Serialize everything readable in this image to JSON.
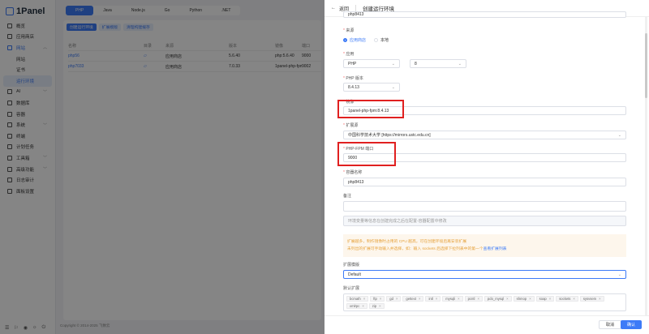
{
  "app": {
    "logo": "1Panel"
  },
  "sidebar": {
    "items": [
      {
        "label": "概览"
      },
      {
        "label": "应用商店"
      },
      {
        "label": "网站"
      },
      {
        "label": "网站"
      },
      {
        "label": "证书"
      },
      {
        "label": "运行环境"
      },
      {
        "label": "AI"
      },
      {
        "label": "数据库"
      },
      {
        "label": "容器"
      },
      {
        "label": "系统"
      },
      {
        "label": "终端"
      },
      {
        "label": "计划任务"
      },
      {
        "label": "工具箱"
      },
      {
        "label": "高级功能"
      },
      {
        "label": "日志审计"
      },
      {
        "label": "面板设置"
      }
    ]
  },
  "runtime_tabs": [
    "PHP",
    "Java",
    "Node.js",
    "Go",
    "Python",
    ".NET"
  ],
  "toolbar": {
    "create": "创建运行环境",
    "extensions": "扩展模版",
    "clean": "清理构建缓存"
  },
  "table": {
    "headers": [
      "名称",
      "目录",
      "来源",
      "版本",
      "镜像",
      "端口"
    ],
    "rows": [
      [
        "php56",
        "",
        "应用商店",
        "5.6.40",
        "php:5.6.40",
        "9000"
      ],
      [
        "php7033",
        "",
        "应用商店",
        "7.0.33",
        "1panel-php-fpm:7....",
        "9002"
      ]
    ]
  },
  "copyright": "Copyright © 2014-2025 飞致云",
  "drawer": {
    "back": "返回",
    "title": "创建运行环境",
    "top_value": "php8413",
    "source_label": "来源",
    "source_options": [
      "应用商店",
      "本地"
    ],
    "app_label": "应用",
    "app_value": "PHP",
    "app_version": "8",
    "php_version_label": "PHP 版本",
    "php_version": "8.4.13",
    "image_label": "镜像",
    "image_value": "1panel-php-fpm:8.4.13",
    "ext_source_label": "扩展源",
    "ext_source_value": "中国科学技术大学 [https://mirrors.ustc.edu.cn]",
    "port_label": "PHP-FPM 端口",
    "port_value": "9000",
    "container_label": "容器名称",
    "container_value": "php8413",
    "remark_label": "备注",
    "env_placeholder": "环境变量等信息在创建完成之后在配置-容器配置中修改",
    "warn_line1": "扩展越多，制作镜像时占用的 CPU 越高，可在创建环境后再安装扩展",
    "warn_line2": "未列出的扩展可手动输入并选择，如：输入 sockets 后选择下拉列表中的第一个",
    "warn_link": "查看扩展列表",
    "template_label": "扩展模版",
    "template_value": "Default",
    "default_ext_label": "默认扩展",
    "extensions": [
      "bcmath",
      "ftp",
      "gd",
      "gettext",
      "intl",
      "mysqli",
      "pcntl",
      "pdo_mysql",
      "shmop",
      "soap",
      "sockets",
      "sysvsem",
      "xmlrpc",
      "zip"
    ],
    "cancel": "取消",
    "confirm": "确认"
  },
  "colors": {
    "accent": "#3d7bf7",
    "highlight": "#e02020"
  }
}
